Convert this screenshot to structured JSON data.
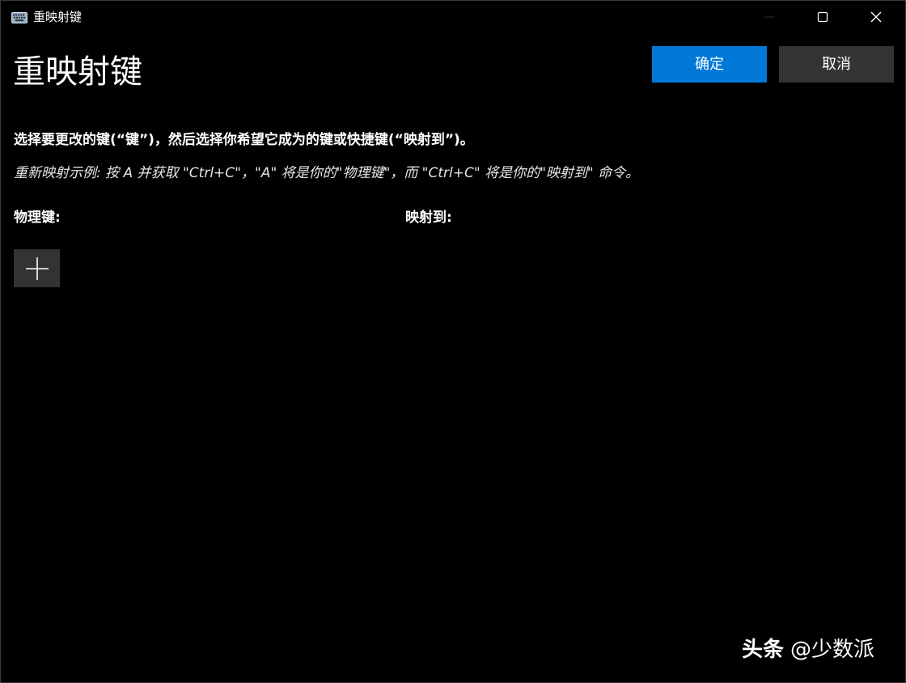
{
  "window": {
    "title": "重映射键",
    "icon": "keyboard-icon"
  },
  "caption": {
    "minimize_icon": "minimize-icon",
    "maximize_icon": "maximize-icon",
    "close_icon": "close-icon"
  },
  "header": {
    "title": "重映射键",
    "ok_label": "确定",
    "cancel_label": "取消"
  },
  "content": {
    "instructions": "选择要更改的键(“键”)，然后选择你希望它成为的键或快捷键(“映射到”)。",
    "example": "重新映射示例: 按 A 并获取 \"Ctrl+C\"，\"A\" 将是你的\"物理键\"，而 \"Ctrl+C\" 将是你的\"映射到\" 命令。",
    "physical_key_label": "物理键:",
    "mapped_to_label": "映射到:",
    "add_button_icon": "plus-icon"
  },
  "watermark": {
    "brand": "头条",
    "handle": "@少数派"
  },
  "colors": {
    "background": "#000000",
    "accent": "#0078d7",
    "secondary_button": "#333333",
    "text": "#ffffff"
  }
}
